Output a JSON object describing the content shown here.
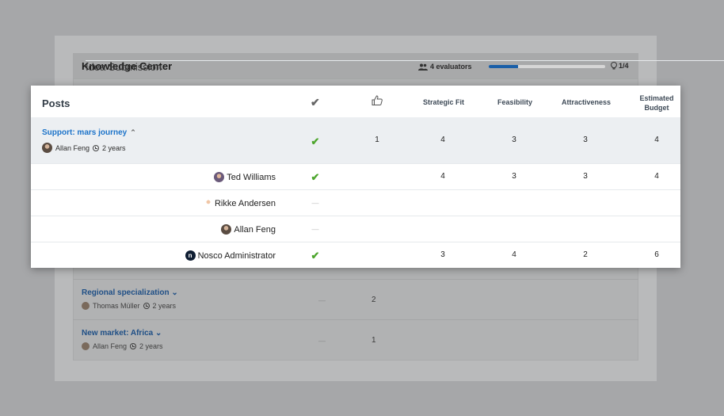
{
  "background": {
    "app_name": "Knowledge Center",
    "page_name": "Idea Submission",
    "evaluators": "4 evaluators",
    "progress": 0.25,
    "step": "1/4",
    "rows": [
      {
        "title": "Regional specialization",
        "author": "Thomas Müller",
        "age": "2 years",
        "vote": "—",
        "count": "2"
      },
      {
        "title": "New market: Africa",
        "author": "Allan Feng",
        "age": "2 years",
        "vote": "—",
        "count": "1"
      }
    ]
  },
  "table": {
    "posts_label": "Posts",
    "columns": {
      "check_icon": "check-icon",
      "like_icon": "thumbs-up-icon",
      "strategic_fit": "Strategic Fit",
      "feasibility": "Feasibility",
      "attractiveness": "Attractiveness",
      "estimated_budget": "Estimated Budget"
    },
    "parent": {
      "title": "Support: mars journey",
      "author": "Allan Feng",
      "age": "2 years",
      "likes": "1",
      "strategic_fit": "4",
      "feasibility": "3",
      "attractiveness": "3",
      "estimated_budget": "4"
    },
    "evaluators": [
      {
        "name": "Ted Williams",
        "status": "done",
        "strategic_fit": "4",
        "feasibility": "3",
        "attractiveness": "3",
        "estimated_budget": "4"
      },
      {
        "name": "Rikke Andersen",
        "status": "pending",
        "strategic_fit": "",
        "feasibility": "",
        "attractiveness": "",
        "estimated_budget": ""
      },
      {
        "name": "Allan Feng",
        "status": "pending",
        "strategic_fit": "",
        "feasibility": "",
        "attractiveness": "",
        "estimated_budget": ""
      },
      {
        "name": "Nosco Administrator",
        "status": "done",
        "strategic_fit": "3",
        "feasibility": "4",
        "attractiveness": "2",
        "estimated_budget": "6"
      }
    ],
    "colors": {
      "accent": "#1c73c9",
      "check": "#4ea62e",
      "progress": "#1a5fa8"
    }
  }
}
